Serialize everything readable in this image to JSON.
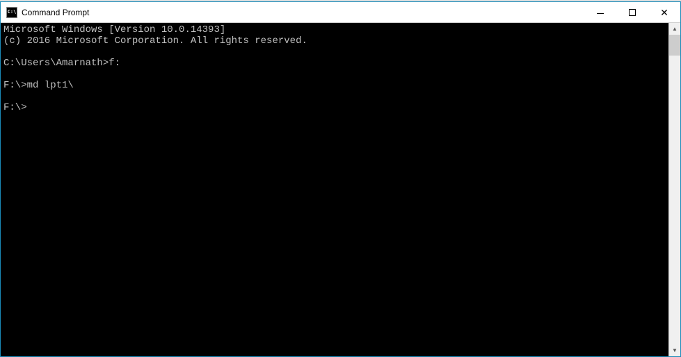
{
  "window": {
    "title": "Command Prompt",
    "icon_text": "C:\\"
  },
  "terminal": {
    "lines": [
      "Microsoft Windows [Version 10.0.14393]",
      "(c) 2016 Microsoft Corporation. All rights reserved.",
      "",
      "C:\\Users\\Amarnath>f:",
      "",
      "F:\\>md lpt1\\",
      "",
      "F:\\>"
    ]
  }
}
